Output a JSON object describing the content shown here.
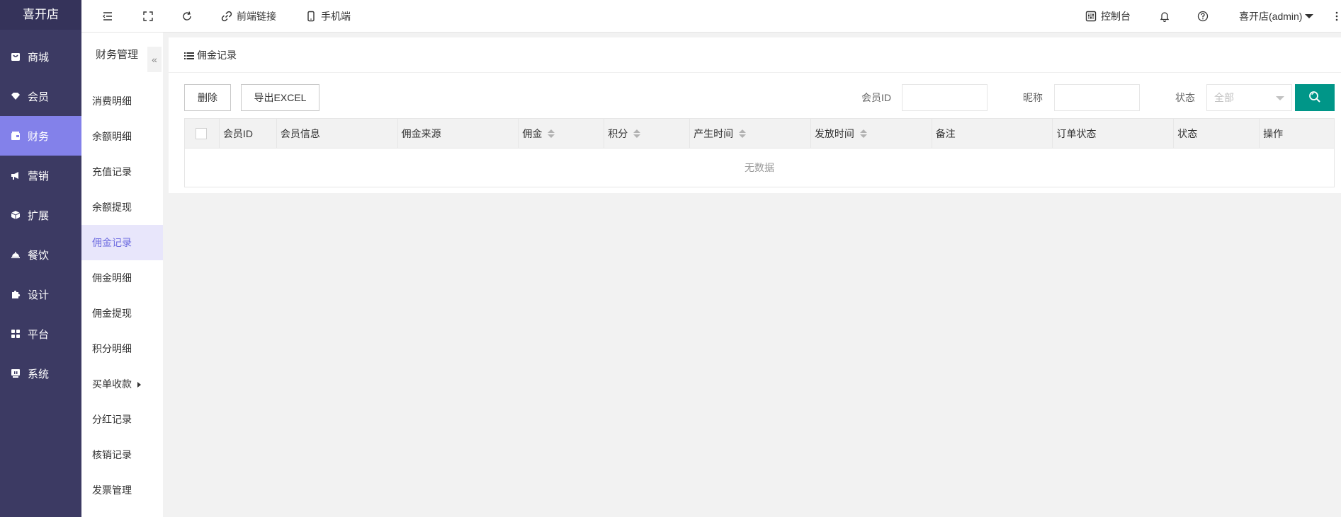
{
  "app": {
    "name": "喜开店"
  },
  "main_nav": {
    "items": [
      {
        "label": "商城",
        "icon": "shop-icon"
      },
      {
        "label": "会员",
        "icon": "member-icon"
      },
      {
        "label": "财务",
        "icon": "wallet-icon",
        "active": true
      },
      {
        "label": "营销",
        "icon": "megaphone-icon"
      },
      {
        "label": "扩展",
        "icon": "cube-icon"
      },
      {
        "label": "餐饮",
        "icon": "dish-icon"
      },
      {
        "label": "设计",
        "icon": "puzzle-icon"
      },
      {
        "label": "平台",
        "icon": "grid-icon"
      },
      {
        "label": "系统",
        "icon": "monitor-icon"
      }
    ]
  },
  "sub_nav": {
    "title": "财务管理",
    "collapse_symbol": "«",
    "items": [
      {
        "label": "消费明细"
      },
      {
        "label": "余额明细"
      },
      {
        "label": "充值记录"
      },
      {
        "label": "余额提现"
      },
      {
        "label": "佣金记录",
        "active": true
      },
      {
        "label": "佣金明细"
      },
      {
        "label": "佣金提现"
      },
      {
        "label": "积分明细"
      },
      {
        "label": "买单收款",
        "has_submenu": true
      },
      {
        "label": "分红记录"
      },
      {
        "label": "核销记录"
      },
      {
        "label": "发票管理"
      }
    ]
  },
  "topbar": {
    "front_link_label": "前端链接",
    "mobile_label": "手机端",
    "console_label": "控制台",
    "user_label": "喜开店(admin)"
  },
  "page": {
    "title": "佣金记录",
    "delete_label": "删除",
    "export_label": "导出EXCEL",
    "filters": {
      "member_id_label": "会员ID",
      "member_id_value": "",
      "nickname_label": "昵称",
      "nickname_value": "",
      "status_label": "状态",
      "status_value": "全部"
    },
    "table": {
      "columns": [
        {
          "label": "会员ID",
          "sortable": false
        },
        {
          "label": "会员信息",
          "sortable": false
        },
        {
          "label": "佣金来源",
          "sortable": false
        },
        {
          "label": "佣金",
          "sortable": true
        },
        {
          "label": "积分",
          "sortable": true
        },
        {
          "label": "产生时间",
          "sortable": true
        },
        {
          "label": "发放时间",
          "sortable": true
        },
        {
          "label": "备注",
          "sortable": false
        },
        {
          "label": "订单状态",
          "sortable": false
        },
        {
          "label": "状态",
          "sortable": false
        },
        {
          "label": "操作",
          "sortable": false
        }
      ],
      "rows": [],
      "empty_text": "无数据"
    }
  },
  "colors": {
    "sidebar_bg": "#3c3a63",
    "sidebar_active": "#8381ea",
    "submenu_active_bg": "#e8e6fb",
    "submenu_active_text": "#6e6ce0",
    "search_button": "#009688"
  }
}
